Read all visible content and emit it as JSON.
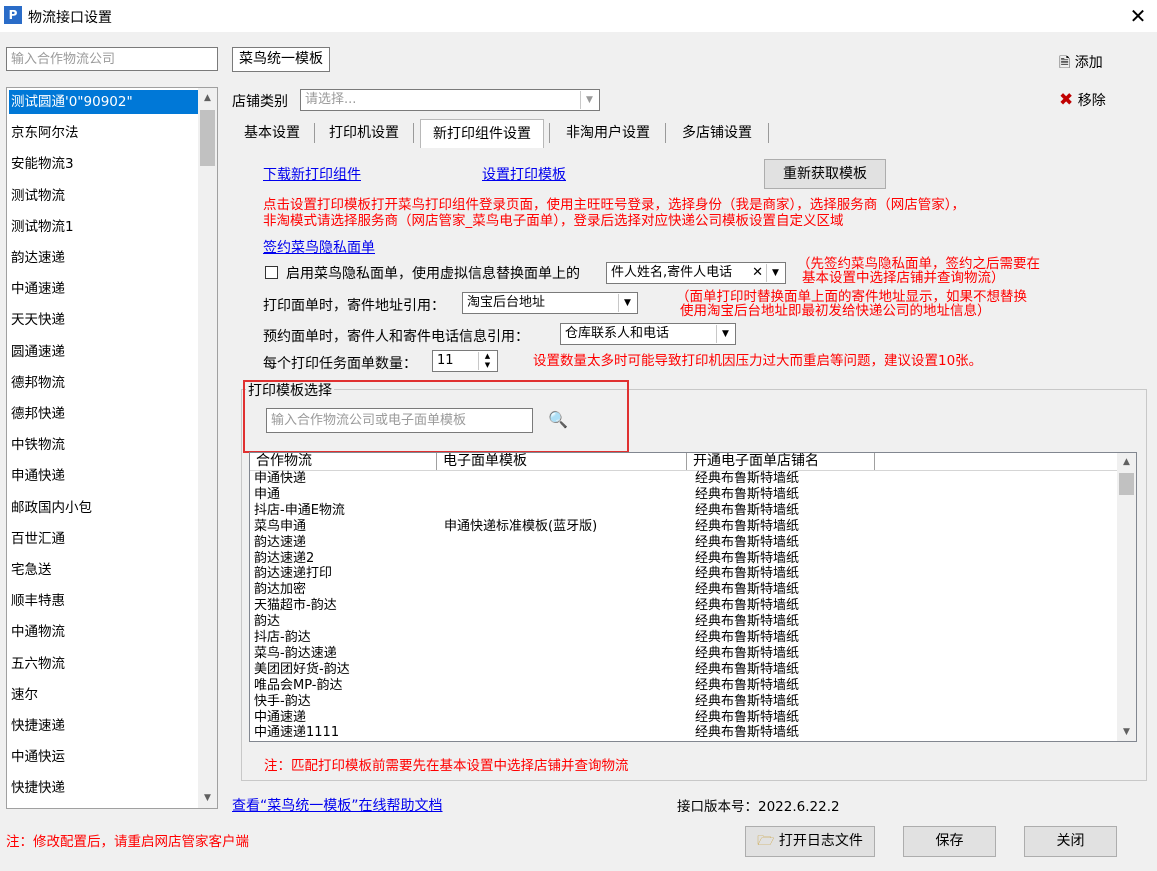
{
  "window": {
    "title": "物流接口设置",
    "app_icon_glyph": "P"
  },
  "left": {
    "search_placeholder": "输入合作物流公司",
    "carriers": [
      "测试圆通'0\"90902\"",
      "京东阿尔法",
      "安能物流3",
      "测试物流",
      "测试物流1",
      "韵达速递",
      "中通速递",
      "天天快递",
      "圆通速递",
      "德邦物流",
      "德邦快递",
      "中铁物流",
      "申通快递",
      "邮政国内小包",
      "百世汇通",
      "宅急送",
      "顺丰特惠",
      "中通物流",
      "五六物流",
      "速尔",
      "快捷速递",
      "中通快运",
      "快捷快递"
    ],
    "selected_index": 0,
    "bottom_note": "注：修改配置后，请重启网店管家客户端"
  },
  "header": {
    "template_name": "菜鸟统一模板",
    "add_label": "添加",
    "remove_label": "移除",
    "shop_type_label": "店铺类别",
    "shop_type_placeholder": "请选择..."
  },
  "tabs": [
    "基本设置",
    "打印机设置",
    "新打印组件设置",
    "非淘用户设置",
    "多店铺设置"
  ],
  "active_tab": 2,
  "panel": {
    "download_link": "下载新打印组件",
    "setup_link": "设置打印模板",
    "refresh_button": "重新获取模板",
    "instruction_line1": "点击设置打印模板打开菜鸟打印组件登录页面，使用主旺旺号登录，选择身份（我是商家），选择服务商（网店管家），",
    "instruction_line2": "非淘模式请选择服务商（网店管家_菜鸟电子面单），登录后选择对应快递公司模板设置自定义区域",
    "sign_link": "签约菜鸟隐私面单",
    "privacy_checkbox_label": "启用菜鸟隐私面单，使用虚拟信息替换面单上的",
    "privacy_combo_value": "件人姓名,寄件人电话",
    "privacy_note_line1": "（先签约菜鸟隐私面单，签约之后需要在",
    "privacy_note_line2": "基本设置中选择店铺并查询物流）",
    "sender_address_label": "打印面单时，寄件地址引用：",
    "sender_address_value": "淘宝后台地址",
    "sender_address_note_line1": "（面单打印时替换面单上面的寄件地址显示，如果不想替换",
    "sender_address_note_line2": "使用淘宝后台地址即最初发给快递公司的地址信息）",
    "reserve_label": "预约面单时，寄件人和寄件电话信息引用：",
    "reserve_value": "仓库联系人和电话",
    "count_label": "每个打印任务面单数量：",
    "count_value": "11",
    "count_note": "设置数量太多时可能导致打印机因压力过大而重启等问题，建议设置10张。"
  },
  "template_group": {
    "title": "打印模板选择",
    "search_placeholder": "输入合作物流公司或电子面单模板",
    "columns": [
      "合作物流",
      "电子面单模板",
      "开通电子面单店铺名"
    ],
    "rows": [
      [
        "申通快递",
        "",
        "经典布鲁斯特墙纸"
      ],
      [
        "申通",
        "",
        "经典布鲁斯特墙纸"
      ],
      [
        "抖店-申通E物流",
        "",
        "经典布鲁斯特墙纸"
      ],
      [
        "菜鸟申通",
        "申通快递标准模板(蓝牙版)",
        "经典布鲁斯特墙纸"
      ],
      [
        "韵达速递",
        "",
        "经典布鲁斯特墙纸"
      ],
      [
        "韵达速递2",
        "",
        "经典布鲁斯特墙纸"
      ],
      [
        "韵达速递打印",
        "",
        "经典布鲁斯特墙纸"
      ],
      [
        "韵达加密",
        "",
        "经典布鲁斯特墙纸"
      ],
      [
        "天猫超市-韵达",
        "",
        "经典布鲁斯特墙纸"
      ],
      [
        "韵达",
        "",
        "经典布鲁斯特墙纸"
      ],
      [
        "抖店-韵达",
        "",
        "经典布鲁斯特墙纸"
      ],
      [
        "菜鸟-韵达速递",
        "",
        "经典布鲁斯特墙纸"
      ],
      [
        "美团团好货-韵达",
        "",
        "经典布鲁斯特墙纸"
      ],
      [
        "唯品会MP-韵达",
        "",
        "经典布鲁斯特墙纸"
      ],
      [
        "快手-韵达",
        "",
        "经典布鲁斯特墙纸"
      ],
      [
        "中通速递",
        "",
        "经典布鲁斯特墙纸"
      ],
      [
        "中通速递1111",
        "",
        "经典布鲁斯特墙纸"
      ]
    ],
    "note": "注：匹配打印模板前需要先在基本设置中选择店铺并查询物流"
  },
  "footer": {
    "help_link": "查看“菜鸟统一模板”在线帮助文档",
    "version_label": "接口版本号：2022.6.22.2",
    "open_log_button": "打开日志文件",
    "save_button": "保存",
    "close_button": "关闭"
  },
  "colors": {
    "selection": "#0078d7",
    "note_red": "#ff0000",
    "link_blue": "#0000ee",
    "highlight_box": "#e03030"
  }
}
